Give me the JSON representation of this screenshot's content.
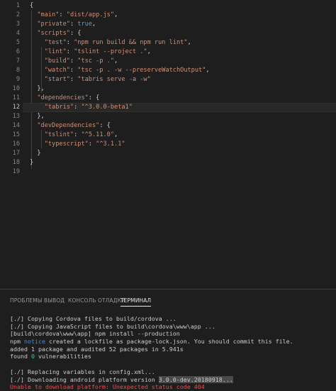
{
  "editor": {
    "active_line": 12,
    "lines": [
      {
        "n": "1",
        "parts": [
          {
            "t": "{",
            "c": "p"
          }
        ]
      },
      {
        "n": "2",
        "parts": [
          {
            "t": "  ",
            "c": "p"
          },
          {
            "t": "\"main\"",
            "c": "k"
          },
          {
            "t": ": ",
            "c": "p"
          },
          {
            "t": "\"dist/app.js\"",
            "c": "s"
          },
          {
            "t": ",",
            "c": "p"
          }
        ]
      },
      {
        "n": "3",
        "parts": [
          {
            "t": "  ",
            "c": "p"
          },
          {
            "t": "\"private\"",
            "c": "k"
          },
          {
            "t": ": ",
            "c": "p"
          },
          {
            "t": "true",
            "c": "v"
          },
          {
            "t": ",",
            "c": "p"
          }
        ]
      },
      {
        "n": "4",
        "parts": [
          {
            "t": "  ",
            "c": "p"
          },
          {
            "t": "\"scripts\"",
            "c": "k"
          },
          {
            "t": ": {",
            "c": "p"
          }
        ]
      },
      {
        "n": "5",
        "parts": [
          {
            "t": "    ",
            "c": "p"
          },
          {
            "t": "\"test\"",
            "c": "k"
          },
          {
            "t": ": ",
            "c": "p"
          },
          {
            "t": "\"npm run build && npm run lint\"",
            "c": "s"
          },
          {
            "t": ",",
            "c": "p"
          }
        ]
      },
      {
        "n": "6",
        "parts": [
          {
            "t": "    ",
            "c": "p"
          },
          {
            "t": "\"lint\"",
            "c": "k"
          },
          {
            "t": ": ",
            "c": "p"
          },
          {
            "t": "\"tslint --project .\"",
            "c": "s"
          },
          {
            "t": ",",
            "c": "p"
          }
        ]
      },
      {
        "n": "7",
        "parts": [
          {
            "t": "    ",
            "c": "p"
          },
          {
            "t": "\"build\"",
            "c": "k"
          },
          {
            "t": ": ",
            "c": "p"
          },
          {
            "t": "\"tsc -p .\"",
            "c": "s"
          },
          {
            "t": ",",
            "c": "p"
          }
        ]
      },
      {
        "n": "8",
        "parts": [
          {
            "t": "    ",
            "c": "p"
          },
          {
            "t": "\"watch\"",
            "c": "k"
          },
          {
            "t": ": ",
            "c": "p"
          },
          {
            "t": "\"tsc -p . -w --preserveWatchOutput\"",
            "c": "s"
          },
          {
            "t": ",",
            "c": "p"
          }
        ]
      },
      {
        "n": "9",
        "parts": [
          {
            "t": "    ",
            "c": "p"
          },
          {
            "t": "\"start\"",
            "c": "k"
          },
          {
            "t": ": ",
            "c": "p"
          },
          {
            "t": "\"tabris serve -a -w\"",
            "c": "s"
          }
        ]
      },
      {
        "n": "10",
        "parts": [
          {
            "t": "  },",
            "c": "p"
          }
        ]
      },
      {
        "n": "11",
        "parts": [
          {
            "t": "  ",
            "c": "p"
          },
          {
            "t": "\"dependencies\"",
            "c": "k"
          },
          {
            "t": ": {",
            "c": "p"
          }
        ]
      },
      {
        "n": "12",
        "parts": [
          {
            "t": "    ",
            "c": "p"
          },
          {
            "t": "\"tabris\"",
            "c": "k"
          },
          {
            "t": ": ",
            "c": "p"
          },
          {
            "t": "\"^3.0.0-beta1\"",
            "c": "s"
          }
        ]
      },
      {
        "n": "13",
        "parts": [
          {
            "t": "  },",
            "c": "p"
          }
        ]
      },
      {
        "n": "14",
        "parts": [
          {
            "t": "  ",
            "c": "p"
          },
          {
            "t": "\"devDependencies\"",
            "c": "k"
          },
          {
            "t": ": {",
            "c": "p"
          }
        ]
      },
      {
        "n": "15",
        "parts": [
          {
            "t": "    ",
            "c": "p"
          },
          {
            "t": "\"tslint\"",
            "c": "k"
          },
          {
            "t": ": ",
            "c": "p"
          },
          {
            "t": "\"^5.11.0\"",
            "c": "s"
          },
          {
            "t": ",",
            "c": "p"
          }
        ]
      },
      {
        "n": "16",
        "parts": [
          {
            "t": "    ",
            "c": "p"
          },
          {
            "t": "\"typescript\"",
            "c": "k"
          },
          {
            "t": ": ",
            "c": "p"
          },
          {
            "t": "\"^3.1.1\"",
            "c": "s"
          }
        ]
      },
      {
        "n": "17",
        "parts": [
          {
            "t": "  }",
            "c": "p"
          }
        ]
      },
      {
        "n": "18",
        "parts": [
          {
            "t": "}",
            "c": "p"
          }
        ]
      },
      {
        "n": "19",
        "parts": []
      }
    ]
  },
  "panel": {
    "tabs": [
      {
        "label": "ПРОБЛЕМЫ",
        "active": false
      },
      {
        "label": "ВЫВОД",
        "active": false
      },
      {
        "label": "КОНСОЛЬ ОТЛАДКИ",
        "active": false
      },
      {
        "label": "ТЕРМИНАЛ",
        "active": true
      }
    ],
    "terminal_lines": [
      [
        {
          "t": "[./] Copying Cordova files to build/cordova ...",
          "c": ""
        }
      ],
      [
        {
          "t": "[./] Copying JavaScript files to build\\cordova\\www\\app ...",
          "c": ""
        }
      ],
      [
        {
          "t": "[build\\cordova\\www\\app] npm install --production",
          "c": ""
        }
      ],
      [
        {
          "t": "npm ",
          "c": ""
        },
        {
          "t": "notice",
          "c": "blue"
        },
        {
          "t": " created a lockfile as package-lock.json. You should commit this file.",
          "c": ""
        }
      ],
      [
        {
          "t": "added 1 package and audited 52 packages in 5.941s",
          "c": ""
        }
      ],
      [
        {
          "t": "found ",
          "c": ""
        },
        {
          "t": "0",
          "c": "green"
        },
        {
          "t": " vulnerabilities",
          "c": ""
        }
      ],
      [
        {
          "t": " ",
          "c": ""
        }
      ],
      [
        {
          "t": "[./] Replacing variables in config.xml...",
          "c": ""
        }
      ],
      [
        {
          "t": "[./] Downloading android platform version ",
          "c": ""
        },
        {
          "t": "3.0.0-dev.20180918...",
          "c": "sel"
        }
      ],
      [
        {
          "t": "Unable to download platform: Unexpected status code 404",
          "c": "red"
        }
      ]
    ]
  },
  "colors": {
    "background": "#1e1e1e",
    "json_key": "#ce9178",
    "json_string": "#ce9178",
    "json_literal": "#569cd6",
    "line_number": "#858585",
    "error": "#f14c4c",
    "notice": "#3b8eea",
    "success": "#23d18b"
  }
}
